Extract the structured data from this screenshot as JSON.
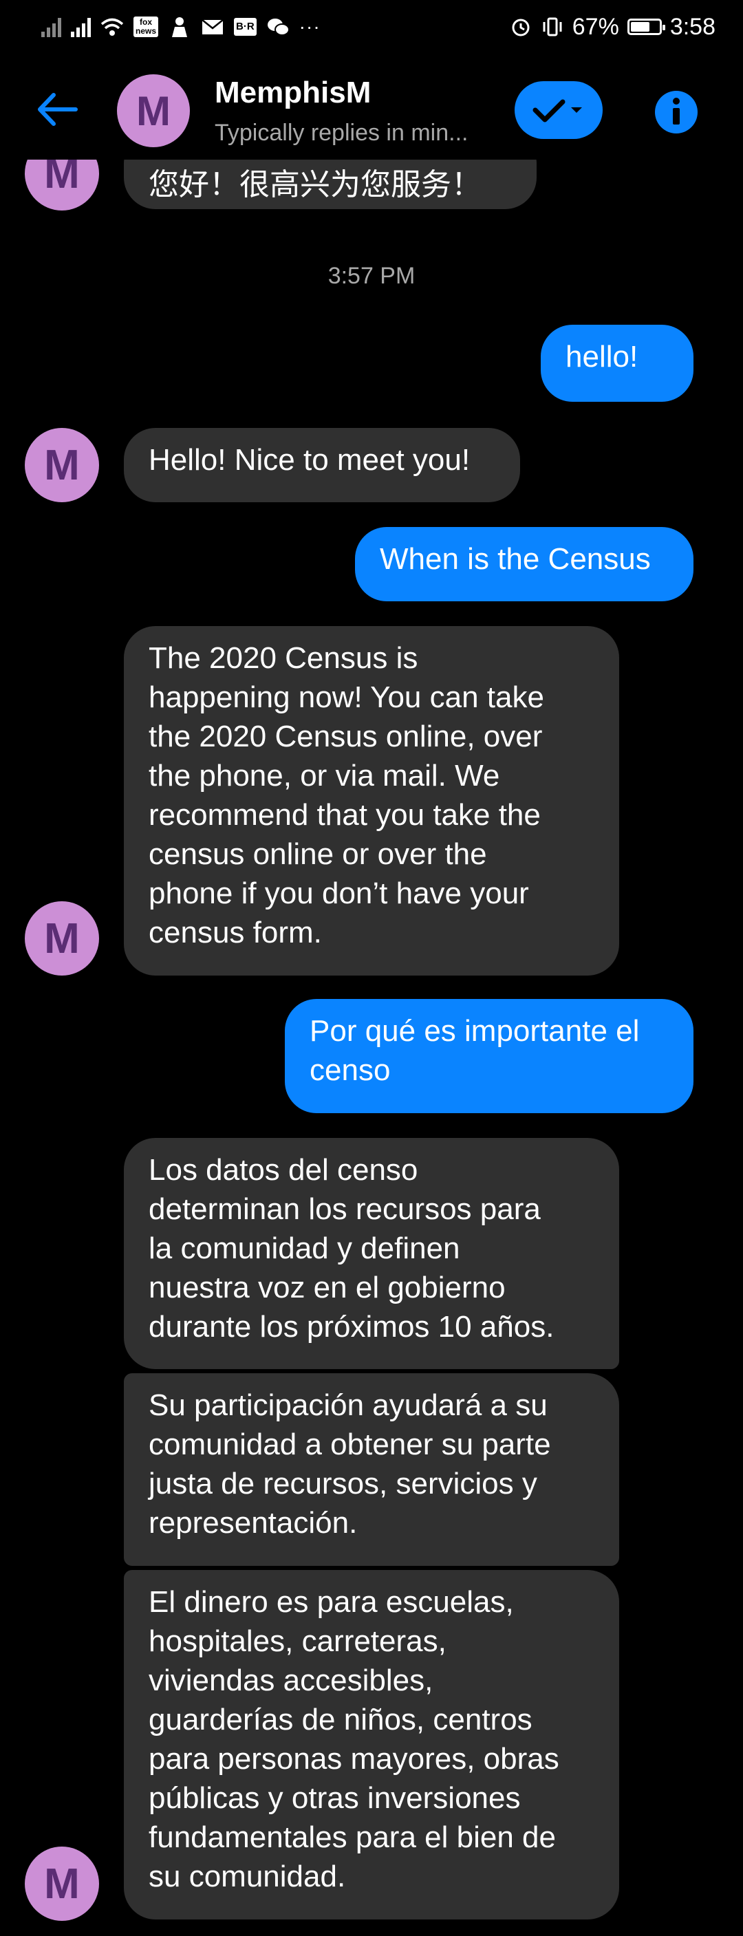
{
  "status_bar": {
    "battery_percent": "67%",
    "battery_level": 0.67,
    "time": "3:58",
    "more": "···",
    "fox_label": "fox news",
    "br_label": "B·R"
  },
  "header": {
    "avatar_letter": "M",
    "title": "MemphisM",
    "subtitle": "Typically replies in min..."
  },
  "messages": {
    "top_partial": "您好！很高兴为您服务！",
    "timestamp": "3:57 PM",
    "out_1": "hello!",
    "in_1": "Hello! Nice to meet you!",
    "out_2": "When is the Census",
    "in_2": "The 2020 Census is\nhappening now! You can take\nthe 2020 Census online, over\nthe phone, or via mail.  We\nrecommend that you take the\ncensus online or over the\nphone if you don’t have your\ncensus form.",
    "out_3": "Por qué es importante el\ncenso",
    "in_3": "Los datos del censo\ndeterminan los recursos para\nla comunidad y definen\nnuestra voz en el gobierno\ndurante los próximos 10 años.",
    "in_4": "Su participación ayudará a su\ncomunidad a obtener su parte\njusta de recursos, servicios y\nrepresentación.",
    "in_5": "El dinero es para escuelas,\nhospitales, carreteras,\nviviendas accesibles,\nguarderías de niños, centros\npara personas mayores, obras\npúblicas y otras inversiones\nfundamentales para el bien de\nsu comunidad.",
    "avatar_letter": "M"
  },
  "colors": {
    "accent": "#0a84ff",
    "incoming_bubble": "#303030",
    "avatar_bg": "#cc8fd6",
    "avatar_fg": "#5b2d74"
  }
}
